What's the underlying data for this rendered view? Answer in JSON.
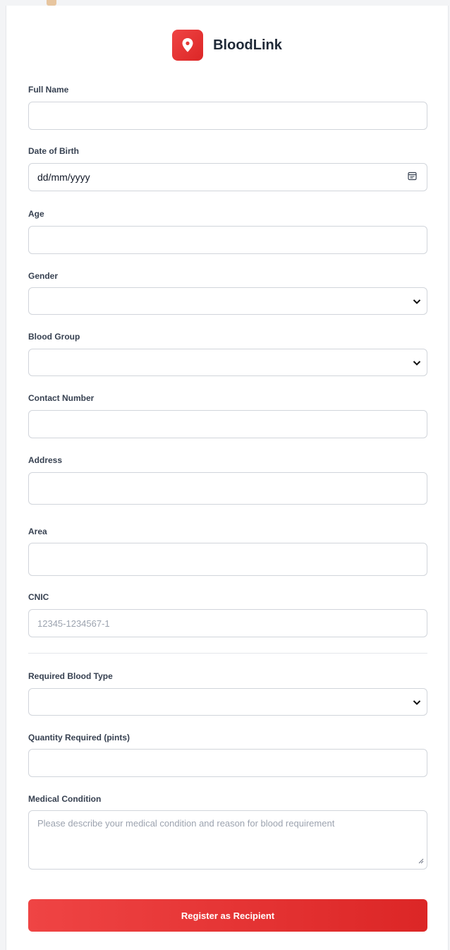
{
  "brand": {
    "name": "BloodLink",
    "logo_icon": "map-pin-icon",
    "accent": "#e53935"
  },
  "form": {
    "full_name": {
      "label": "Full Name",
      "value": ""
    },
    "dob": {
      "label": "Date of Birth",
      "value": "dd/mm/yyyy",
      "icon": "calendar-icon"
    },
    "age": {
      "label": "Age",
      "value": ""
    },
    "gender": {
      "label": "Gender",
      "value": "",
      "icon": "chevron-down-icon"
    },
    "blood_group": {
      "label": "Blood Group",
      "value": "",
      "icon": "chevron-down-icon"
    },
    "contact": {
      "label": "Contact Number",
      "value": ""
    },
    "address": {
      "label": "Address",
      "value": ""
    },
    "area": {
      "label": "Area",
      "value": ""
    },
    "cnic": {
      "label": "CNIC",
      "placeholder": "12345-1234567-1"
    },
    "required_blood_type": {
      "label": "Required Blood Type",
      "value": "",
      "icon": "chevron-down-icon"
    },
    "quantity": {
      "label": "Quantity Required (pints)",
      "value": ""
    },
    "medical_condition": {
      "label": "Medical Condition",
      "placeholder": "Please describe your medical condition and reason for blood requirement"
    },
    "submit_label": "Register as Recipient"
  }
}
